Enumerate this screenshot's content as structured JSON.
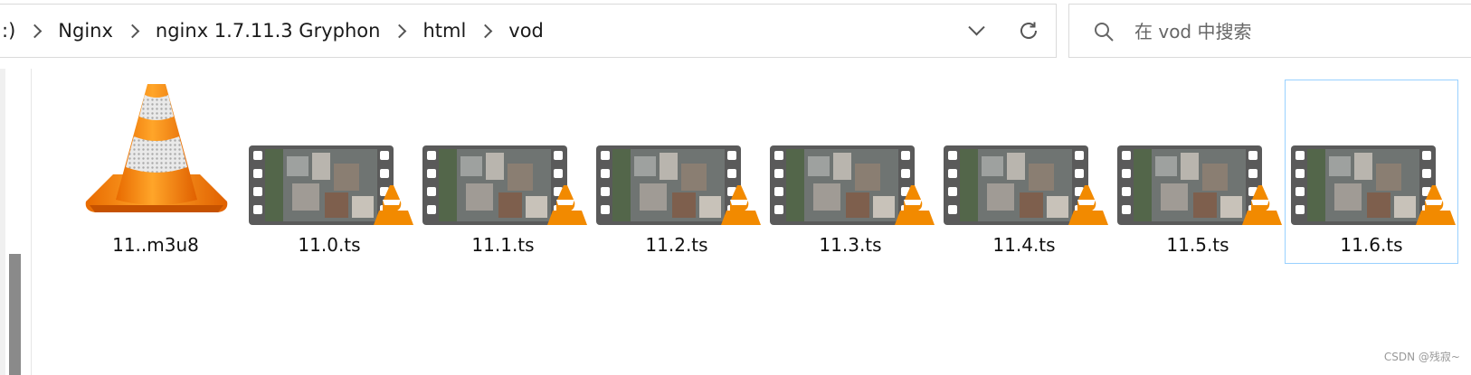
{
  "address": {
    "crumbs": [
      ":)",
      "Nginx",
      "nginx 1.7.11.3 Gryphon",
      "html",
      "vod"
    ]
  },
  "search": {
    "placeholder": "在 vod 中搜索"
  },
  "icons": {
    "dropdown": "chevron-down-icon",
    "refresh": "refresh-icon",
    "search": "search-icon",
    "playlist": "vlc-cone-icon",
    "video": "video-film-thumbnail-icon"
  },
  "files": [
    {
      "name": "11..m3u8",
      "kind": "playlist",
      "selected": false
    },
    {
      "name": "11.0.ts",
      "kind": "video",
      "selected": false
    },
    {
      "name": "11.1.ts",
      "kind": "video",
      "selected": false
    },
    {
      "name": "11.2.ts",
      "kind": "video",
      "selected": false
    },
    {
      "name": "11.3.ts",
      "kind": "video",
      "selected": false
    },
    {
      "name": "11.4.ts",
      "kind": "video",
      "selected": false
    },
    {
      "name": "11.5.ts",
      "kind": "video",
      "selected": false
    },
    {
      "name": "11.6.ts",
      "kind": "video",
      "selected": true
    }
  ],
  "colors": {
    "selection_border": "#99d1ff",
    "vlc_orange": "#f28a00",
    "film_frame": "#5a5a5a"
  },
  "watermark": "CSDN @残寂~"
}
